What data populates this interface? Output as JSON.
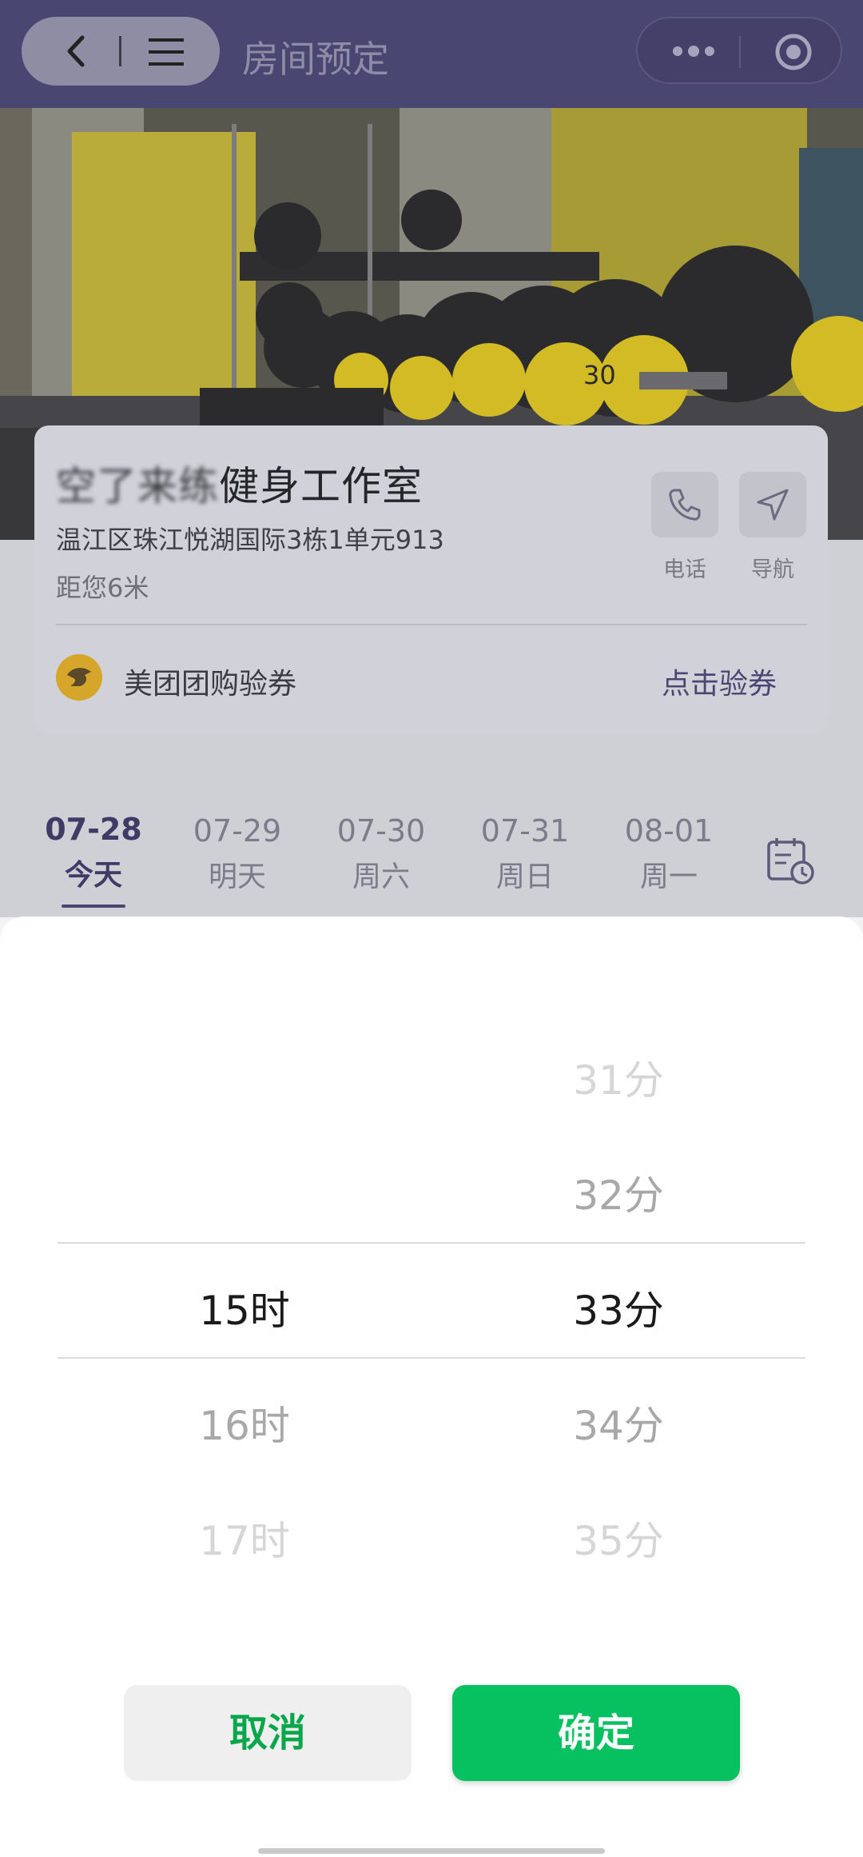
{
  "navbar": {
    "title": "房间预定"
  },
  "store": {
    "name_blurred": "空了来练",
    "name_clear": "健身工作室",
    "address": "温江区珠江悦湖国际3栋1单元913",
    "distance": "距您6米",
    "phone_label": "电话",
    "nav_label": "导航"
  },
  "coupon": {
    "label": "美团团购验券",
    "action": "点击验券"
  },
  "dates": [
    {
      "date": "07-28",
      "day": "今天"
    },
    {
      "date": "07-29",
      "day": "明天"
    },
    {
      "date": "07-30",
      "day": "周六"
    },
    {
      "date": "07-31",
      "day": "周日"
    },
    {
      "date": "08-01",
      "day": "周一"
    }
  ],
  "picker": {
    "hours": [
      "15时",
      "16时",
      "17时"
    ],
    "minutes": [
      "31分",
      "32分",
      "33分",
      "34分",
      "35分"
    ],
    "selected_hour": "15时",
    "selected_minute": "33分"
  },
  "buttons": {
    "cancel": "取消",
    "confirm": "确定"
  },
  "colors": {
    "primary": "#07c160",
    "nav": "#4a4672"
  }
}
